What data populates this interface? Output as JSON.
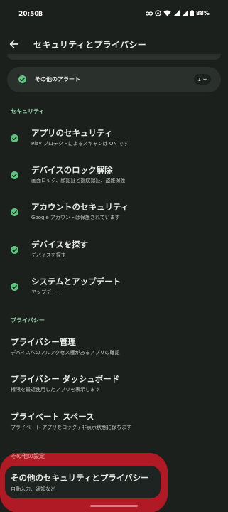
{
  "status_bar": {
    "time": "20:50",
    "extra_glyph": "B",
    "battery": "88%",
    "icons": [
      "link-icon",
      "vibrate-icon",
      "wifi-icon",
      "signal-icon",
      "signal-icon",
      "battery-icon"
    ]
  },
  "app_bar": {
    "back_icon": "arrow-back-icon",
    "title": "セキュリティとプライバシー"
  },
  "alert_card": {
    "label": "その他のアラート",
    "count": "1",
    "status_icon": "check-circle-icon"
  },
  "sections": {
    "security": "セキュリティ",
    "privacy": "プライバシー",
    "other": "その他の設定"
  },
  "security_items": [
    {
      "title": "アプリのセキュリティ",
      "subtitle": "Play プロテクトによるスキャンは ON です"
    },
    {
      "title": "デバイスのロック解除",
      "subtitle": "画面ロック、顔認証と指紋認証、盗難保護"
    },
    {
      "title": "アカウントのセキュリティ",
      "subtitle": "Google アカウントは保護されています"
    },
    {
      "title": "デバイスを探す",
      "subtitle": "デバイスを探す"
    },
    {
      "title": "システムとアップデート",
      "subtitle": "アップデート"
    }
  ],
  "privacy_items": [
    {
      "title": "プライバシー管理",
      "subtitle": "デバイスへのフルアクセス権があるアプリの確認"
    },
    {
      "title": "プライバシー ダッシュボード",
      "subtitle": "権限を最近使用したアプリを表示します"
    },
    {
      "title": "プライベート スペース",
      "subtitle": "プライベート アプリをロック / 非表示状態に保ちます"
    }
  ],
  "other_items": [
    {
      "title": "その他のセキュリティとプライバシー",
      "subtitle": "自動入力、通知など"
    }
  ],
  "colors": {
    "background": "#1b201d",
    "card": "#2a302c",
    "check_green": "#5cc47e",
    "section_green": "#8fd3a6",
    "highlight_red": "#b01a24"
  }
}
